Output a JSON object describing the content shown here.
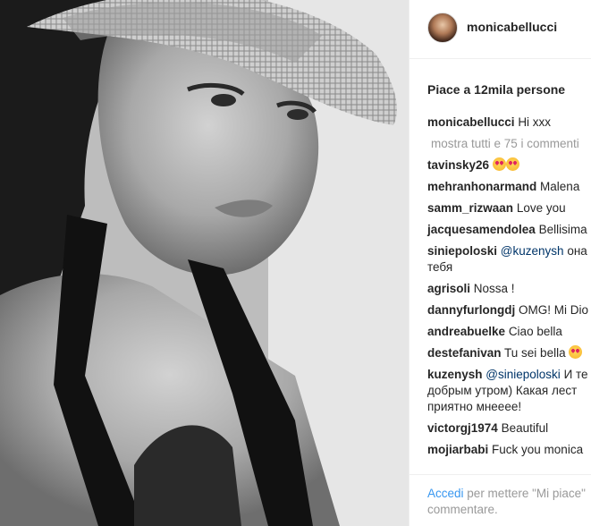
{
  "post": {
    "username": "monicabellucci",
    "likes": "Piace a 12mila persone",
    "caption": {
      "user": "monicabellucci",
      "text": "Hi xxx"
    },
    "show_all": "mostra tutti e 75 i commenti",
    "comments": [
      {
        "user": "tavinsky26",
        "text": "",
        "emoji": 2
      },
      {
        "user": "mehranhonarmand",
        "text": "Malena"
      },
      {
        "user": "samm_rizwaan",
        "text": "Love you"
      },
      {
        "user": "jacquesamendolea",
        "text": "Bellisima"
      },
      {
        "user": "siniepoloski",
        "mention": "@kuzenysh",
        "text": "она",
        "text2": "тебя"
      },
      {
        "user": "agrisoli",
        "text": "Nossa !"
      },
      {
        "user": "dannyfurlongdj",
        "text": "OMG! Mi Dio"
      },
      {
        "user": "andreabuelke",
        "text": "Ciao bella"
      },
      {
        "user": "destefanivan",
        "text": "Tu sei bella",
        "emoji": 1
      },
      {
        "user": "kuzenysh",
        "mention": "@siniepoloski",
        "text": "И те",
        "text2": "добрым утром) Какая лест",
        "text3": "приятно мнееее!"
      },
      {
        "user": "victorgj1974",
        "text": "Beautiful"
      },
      {
        "user": "mojiarbabi",
        "text": "Fuck you monica"
      }
    ],
    "login_link": "Accedi",
    "login_text": "per mettere \"Mi piace\"",
    "login_text2": "commentare."
  }
}
